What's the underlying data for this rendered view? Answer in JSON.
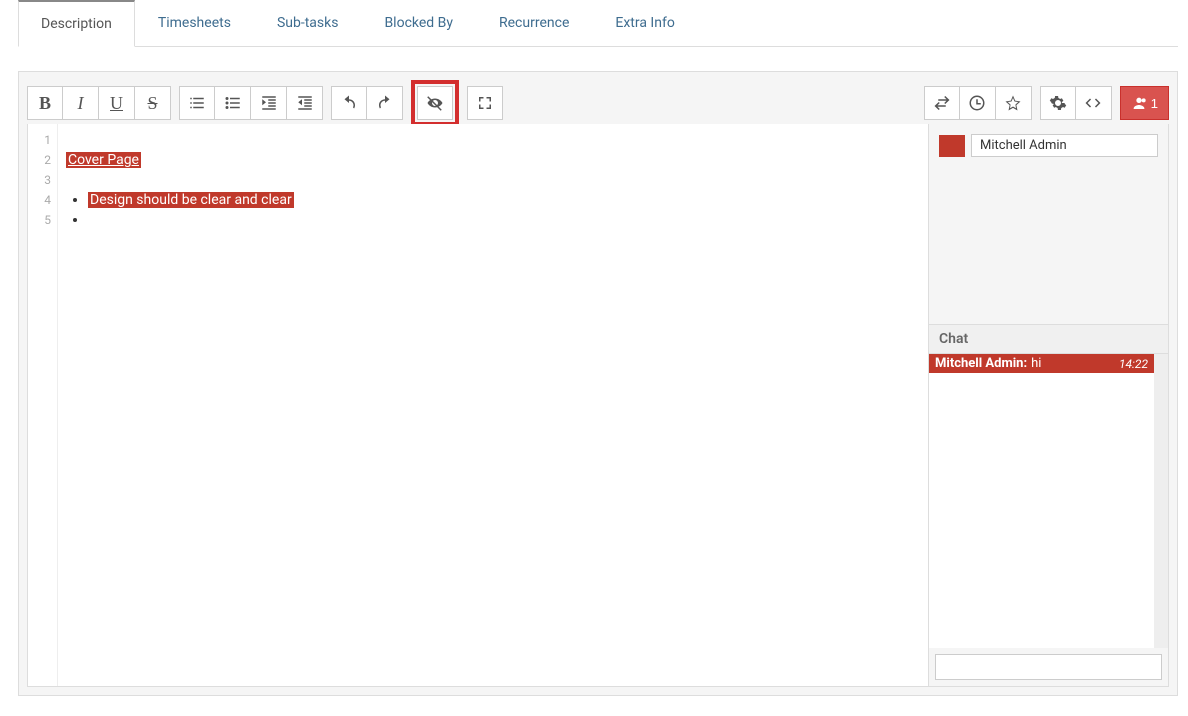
{
  "tabs": {
    "items": [
      {
        "label": "Description",
        "active": true
      },
      {
        "label": "Timesheets",
        "active": false
      },
      {
        "label": "Sub-tasks",
        "active": false
      },
      {
        "label": "Blocked By",
        "active": false
      },
      {
        "label": "Recurrence",
        "active": false
      },
      {
        "label": "Extra Info",
        "active": false
      }
    ]
  },
  "toolbar": {
    "format": {
      "bold": "B",
      "italic": "I",
      "underline": "U",
      "strike": "S"
    },
    "collab_count": "1"
  },
  "gutter": [
    "1",
    "2",
    "3",
    "4",
    "5"
  ],
  "document": {
    "title_text": "Cover Page",
    "bullet1": "Design should be clear and clear"
  },
  "presence": {
    "user_name": "Mitchell Admin",
    "swatch_color": "#c0392b"
  },
  "chat": {
    "header": "Chat",
    "messages": [
      {
        "author": "Mitchell Admin:",
        "text": "hi",
        "time": "14:22"
      }
    ],
    "input_placeholder": ""
  }
}
